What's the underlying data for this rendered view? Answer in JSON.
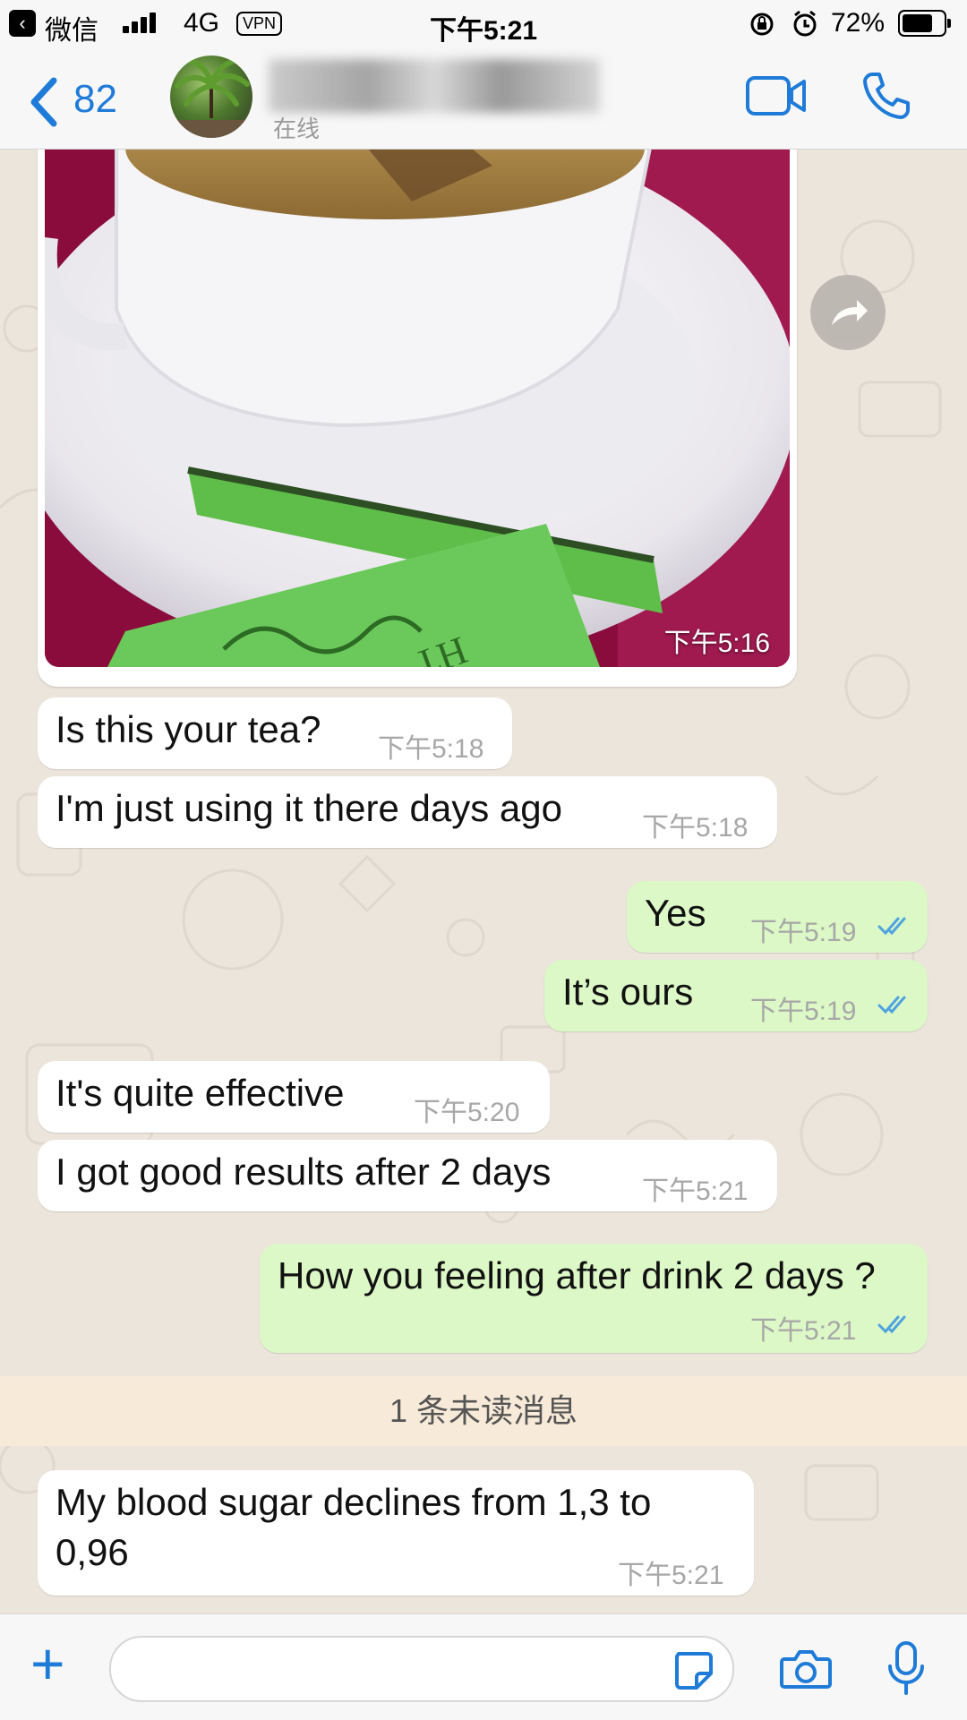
{
  "status_bar": {
    "back_app": "微信",
    "network": "4G",
    "vpn": "VPN",
    "time": "下午5:21",
    "battery": "72%"
  },
  "header": {
    "back_count": "82",
    "contact_status": "在线",
    "icons": [
      "video-call-icon",
      "phone-call-icon"
    ]
  },
  "messages": {
    "image": {
      "time": "下午5:16"
    },
    "m1": {
      "text": "Is this your tea?",
      "time": "下午5:18"
    },
    "m2": {
      "text": "I'm just using it there days ago",
      "time": "下午5:18"
    },
    "m3": {
      "text": "Yes",
      "time": "下午5:19"
    },
    "m4": {
      "text": "It’s ours",
      "time": "下午5:19"
    },
    "m5": {
      "text": "It's quite effective",
      "time": "下午5:20"
    },
    "m6": {
      "text": "I got good results after 2 days",
      "time": "下午5:21"
    },
    "m7": {
      "text": "How you feeling after drink 2 days ?",
      "time": "下午5:21"
    },
    "unread": "1 条未读消息",
    "m8": {
      "line1": "My blood sugar declines from 1,3 to",
      "line2": "0,96",
      "time": "下午5:21"
    }
  },
  "colors": {
    "accent": "#1f7bd8",
    "incoming_bubble": "#ffffff",
    "outgoing_bubble": "#dcf8c6",
    "read_ticks": "#4fa3e0",
    "unread_bar": "#f8ead8"
  }
}
